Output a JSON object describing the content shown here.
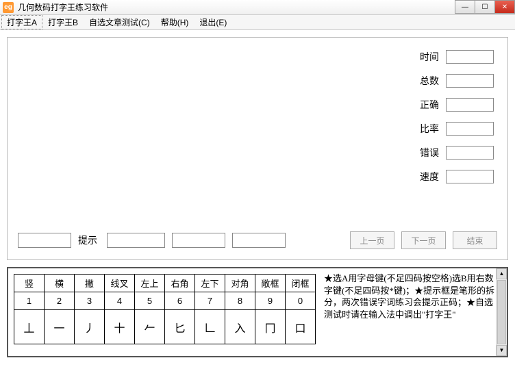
{
  "window": {
    "title": "几何数码打字王练习软件",
    "icon_text": "eg"
  },
  "menu": {
    "items": [
      "打字王A",
      "打字王B",
      "自选文章测试(C)",
      "帮助(H)",
      "退出(E)"
    ]
  },
  "stats": {
    "time_label": "时间",
    "total_label": "总数",
    "correct_label": "正确",
    "rate_label": "比率",
    "error_label": "错误",
    "speed_label": "速度",
    "time": "",
    "total": "",
    "correct": "",
    "rate": "",
    "error": "",
    "speed": ""
  },
  "bottom": {
    "hint_label": "提示",
    "hint_value": "",
    "field1": "",
    "field2": "",
    "field3": "",
    "prev_label": "上一页",
    "next_label": "下一页",
    "end_label": "结束"
  },
  "ref": {
    "headers": [
      "竖",
      "横",
      "撇",
      "线叉",
      "左上",
      "右角",
      "左下",
      "对角",
      "敞框",
      "闭框"
    ],
    "numbers": [
      "1",
      "2",
      "3",
      "4",
      "5",
      "6",
      "7",
      "8",
      "9",
      "0"
    ],
    "shapes": [
      "丄",
      "一",
      "丿",
      "十",
      "𠂉",
      "匕",
      "𠃊",
      "入",
      "冂",
      "口"
    ],
    "note": "★选A用字母键(不足四码按空格)选B用右数字键(不足四码按*键)；★提示框是笔形的拆分，两次错误字词练习会提示正码；★自选测试时请在输入法中调出\"打字王\""
  }
}
